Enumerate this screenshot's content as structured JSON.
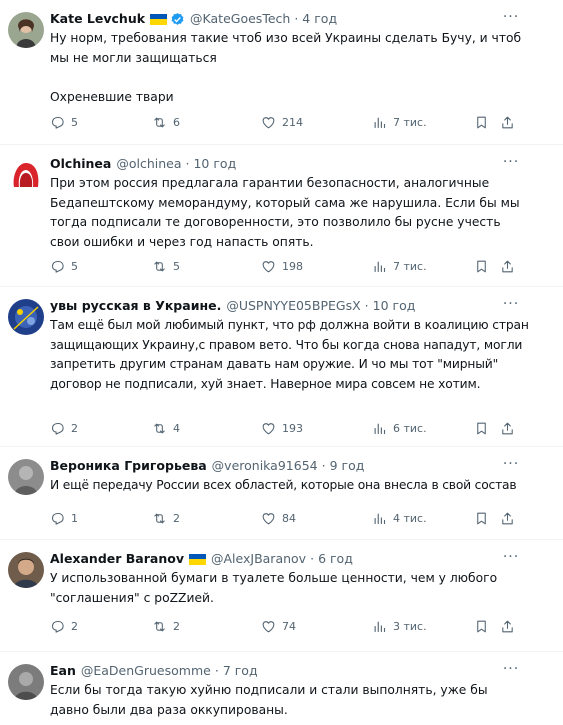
{
  "tweets": [
    {
      "name": "Kate Levchuk",
      "handle": "@KateGoesTech",
      "time": "4 год",
      "text": "Ну норм, требования такие чтоб изо всей Украины сделать Бучу, и чтоб мы не могли защищаться\n\nОхреневшие твари",
      "replies": "5",
      "retweets": "6",
      "likes": "214",
      "views": "7 тис.",
      "flag": true,
      "verified": true
    },
    {
      "name": "Olchinea",
      "handle": "@olchinea",
      "time": "10 год",
      "text": "При этом россия предлагала гарантии безопасности, аналогичные Бедапештскому меморандуму, который сама же нарушила. Если бы мы тогда подписали те договоренности, это позволило бы русне учесть свои ошибки и через год напасть опять.",
      "replies": "5",
      "retweets": "5",
      "likes": "198",
      "views": "7 тис.",
      "flag": false,
      "verified": false
    },
    {
      "name": "увы русская в Украине.",
      "handle": "@USPNYYE05BPEGsX",
      "time": "10 год",
      "text": "Там ещё был мой любимый пункт, что рф должна войти в коалицию стран защищающих Украину,с правом вето. Что бы когда снова нападут, могли запретить другим странам давать нам оружие. И чо мы тот \"мирный\" договор не подписали, хуй знает. Наверное мира совсем не хотим.",
      "replies": "2",
      "retweets": "4",
      "likes": "193",
      "views": "6 тис.",
      "flag": false,
      "verified": false
    },
    {
      "name": "Вероника Григорьева",
      "handle": "@veronika91654",
      "time": "9 год",
      "text": "И ещё передачу России всех областей, которые она внесла в свой состав",
      "replies": "1",
      "retweets": "2",
      "likes": "84",
      "views": "4 тис.",
      "flag": false,
      "verified": false
    },
    {
      "name": "Alexander Baranov",
      "handle": "@AlexJBaranov",
      "time": "6 год",
      "text": "У использованной бумаги в туалете больше ценности, чем у любого \"соглашения\" с poZZией.",
      "replies": "2",
      "retweets": "2",
      "likes": "74",
      "views": "3 тис.",
      "flag": true,
      "verified": false
    },
    {
      "name": "Ean",
      "handle": "@EaDenGruesomme",
      "time": "7 год",
      "text": "Если бы тогда такую хуйню подписали и стали выполнять, уже бы давно были два раза оккупированы.",
      "replies": "",
      "retweets": "",
      "likes": "",
      "views": "",
      "flag": false,
      "verified": false
    }
  ],
  "colors": {
    "text": "#0f1419",
    "muted": "#536471",
    "verified": "#1d9bf0",
    "flag_blue": "#0057b7",
    "flag_yellow": "#ffd700"
  },
  "icons": [
    "more-icon",
    "reply-icon",
    "retweet-icon",
    "like-icon",
    "views-icon",
    "bookmark-icon",
    "share-icon"
  ]
}
